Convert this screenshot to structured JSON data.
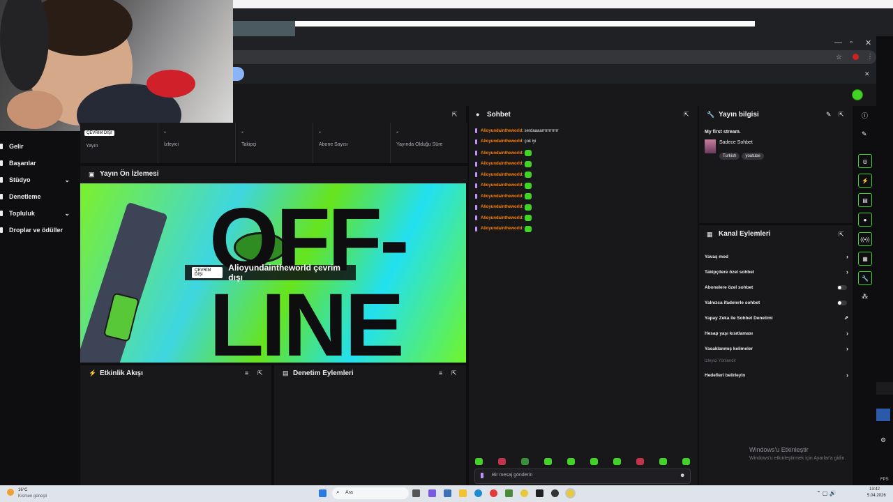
{
  "webcam": {
    "description": ""
  },
  "left_nav": {
    "items": [
      {
        "label": "Gelir",
        "chevron": false
      },
      {
        "label": "Başarılar",
        "chevron": false
      },
      {
        "label": "Stüdyo",
        "chevron": true
      },
      {
        "label": "Denetleme",
        "chevron": false
      },
      {
        "label": "Topluluk",
        "chevron": true
      },
      {
        "label": "Droplar ve ödüller",
        "chevron": false
      }
    ]
  },
  "stats": {
    "offline_chip": "ÇEVRİM DIŞI",
    "items": [
      {
        "value": "",
        "label": "Yayın"
      },
      {
        "value": "-",
        "label": "İzleyici"
      },
      {
        "value": "-",
        "label": "Takipçi"
      },
      {
        "value": "-",
        "label": "Abone Sayısı"
      },
      {
        "value": "-",
        "label": "Yayında Olduğu Süre"
      }
    ]
  },
  "preview": {
    "title": "Yayın Ön İzlemesi",
    "offline_chip": "ÇEVRİM DIŞI",
    "offline_message": "Alioyundaintheworld çevrim dışı",
    "art_text_top": "OFF-",
    "art_text_bottom": "LINE"
  },
  "activity": {
    "title": "Etkinlik Akışı"
  },
  "modlog": {
    "title": "Denetim Eylemleri"
  },
  "chat": {
    "title": "Sohbet",
    "messages": [
      {
        "user": "Alioyundaintheworld",
        "text": ": serdaaaarrrrrrrrrrrr",
        "emote": false
      },
      {
        "user": "Alioyundaintheworld",
        "text": ": çok iyi",
        "emote": false
      },
      {
        "user": "Alioyundaintheworld",
        "text": ":",
        "emote": true
      },
      {
        "user": "Alioyundaintheworld",
        "text": ":",
        "emote": true
      },
      {
        "user": "Alioyundaintheworld",
        "text": ":",
        "emote": true
      },
      {
        "user": "Alioyundaintheworld",
        "text": ":",
        "emote": true
      },
      {
        "user": "Alioyundaintheworld",
        "text": ":",
        "emote": true
      },
      {
        "user": "Alioyundaintheworld",
        "text": ":",
        "emote": true
      },
      {
        "user": "Alioyundaintheworld",
        "text": ":",
        "emote": true
      },
      {
        "user": "Alioyundaintheworld",
        "text": ":",
        "emote": true
      }
    ],
    "input_placeholder": "Bir mesaj gönderin",
    "emote_colors": [
      "#41d325",
      "#c2334b",
      "#3a8f3a",
      "#41d325",
      "#41d325",
      "#41d325",
      "#41d325",
      "#c2334b",
      "#41d325",
      "#41d325"
    ]
  },
  "stream_info": {
    "title": "Yayın bilgisi",
    "stream_title": "My first stream.",
    "category": "Sadece Sohbet",
    "tags": [
      "Turkish",
      "youtube"
    ]
  },
  "channel_actions": {
    "title": "Kanal Eylemleri",
    "rows": [
      {
        "label": "Yavaş mod",
        "control": "arrow"
      },
      {
        "label": "Takipçilere özel sohbet",
        "control": "arrow"
      },
      {
        "label": "Abonelere özel sohbet",
        "control": "toggle"
      },
      {
        "label": "Yalnızca ifadelerle sohbet",
        "control": "toggle"
      },
      {
        "label": "Yapay Zeka ile Sohbet Denetimi",
        "control": "external"
      },
      {
        "label": "Hesap yaşı kısıtlaması",
        "control": "arrow"
      },
      {
        "label": "Yasaklanmış kelimeler",
        "control": "arrow"
      }
    ],
    "section_label": "İzleyici Yönlendir",
    "goal_row": "Hedefleri belirleyin"
  },
  "watermark": {
    "line1": "Windows'u Etkinleştir",
    "line2": "Windows'u etkinleştirmek için Ayarlar'a gidin."
  },
  "taskbar": {
    "weather_temp": "16°C",
    "weather_desc": "Kısmen güneşli",
    "search_placeholder": "Ara",
    "time": "13:42",
    "date": "5.04.2026"
  },
  "misc": {
    "fps_label": "FPS"
  },
  "colors": {
    "accent": "#41d325",
    "username": "#ff7f00",
    "panel": "#18181b",
    "background": "#0e0e10"
  }
}
